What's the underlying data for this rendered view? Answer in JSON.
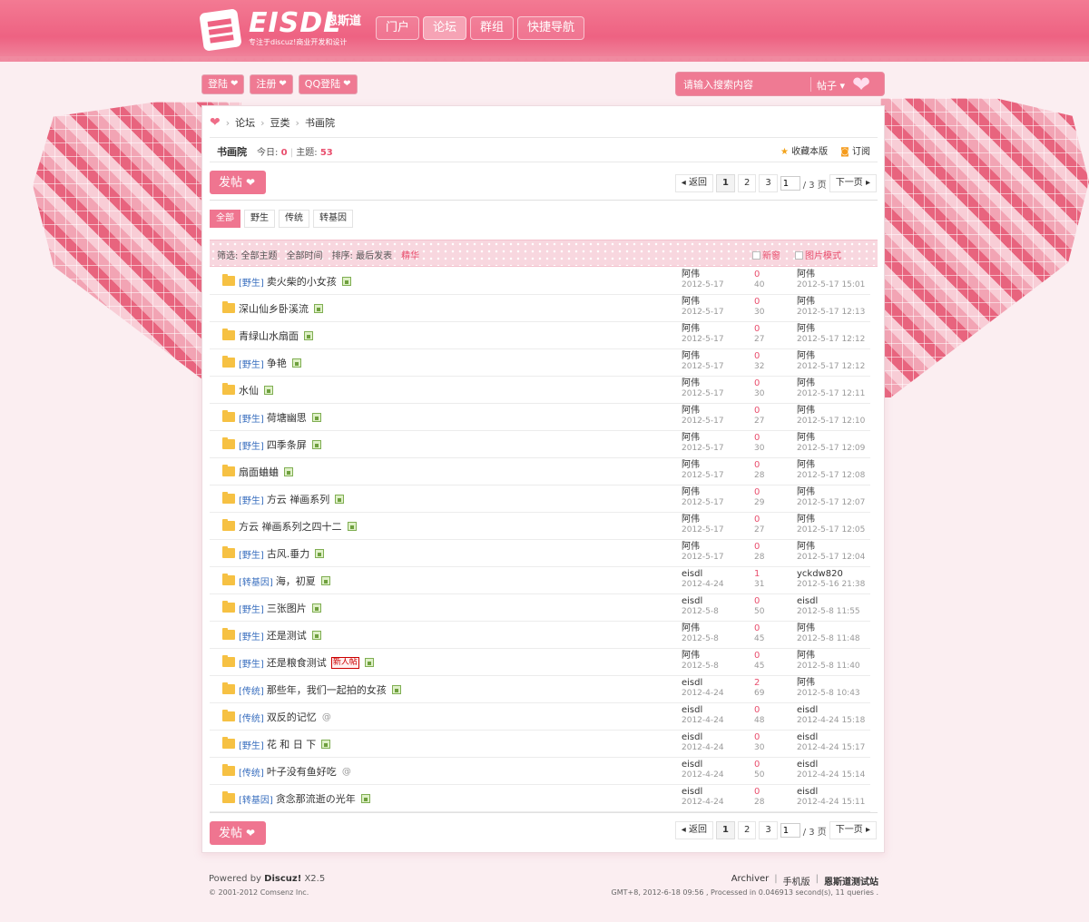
{
  "colors": {
    "brand": "#ee6282",
    "accent": "#ef7590",
    "link": "#3a6fbf",
    "count_red": "#e94f6e",
    "page_bg": "#fbeef1"
  },
  "logo": {
    "text": "EISDL",
    "cn": "恩斯道",
    "slogan": "专注于discuz!商业开发和设计"
  },
  "nav": [
    {
      "label": "门户",
      "active": false
    },
    {
      "label": "论坛",
      "active": true
    },
    {
      "label": "群组",
      "active": false
    },
    {
      "label": "快捷导航",
      "active": false
    }
  ],
  "auth": {
    "login": "登陆",
    "register": "注册",
    "qq_login": "QQ登陆"
  },
  "search": {
    "placeholder": "请输入搜索内容",
    "type": "帖子 ▾"
  },
  "breadcrumb": {
    "forum": "论坛",
    "category": "豆类",
    "board": "书画院"
  },
  "forum": {
    "name": "书画院",
    "today_label": "今日:",
    "today": "0",
    "threads_label": "主题:",
    "threads": "53",
    "favorite": "收藏本版",
    "subscribe": "订阅"
  },
  "post_button": "发帖",
  "pager": {
    "back": "返回",
    "pages": [
      "1",
      "2",
      "3"
    ],
    "current_input": "1",
    "total": "/ 3 页",
    "next": "下一页"
  },
  "type_tabs": [
    {
      "label": "全部",
      "active": true
    },
    {
      "label": "野生",
      "active": false
    },
    {
      "label": "传统",
      "active": false
    },
    {
      "label": "转基因",
      "active": false
    }
  ],
  "filter": {
    "filter_label": "筛选: 全部主题",
    "time": "全部时间",
    "sort": "排序: 最后发表",
    "digest": "精华",
    "new_window": "新窗",
    "image_mode": "图片模式"
  },
  "threads": [
    {
      "cat": "[野生]",
      "title": "卖火柴的小女孩",
      "attach": "img",
      "author": "阿伟",
      "date": "2012-5-17",
      "replies": "0",
      "views": "40",
      "last_user": "阿伟",
      "last_time": "2012-5-17 15:01"
    },
    {
      "cat": "",
      "title": "深山仙乡卧溪流",
      "attach": "img",
      "author": "阿伟",
      "date": "2012-5-17",
      "replies": "0",
      "views": "30",
      "last_user": "阿伟",
      "last_time": "2012-5-17 12:13"
    },
    {
      "cat": "",
      "title": "青绿山水扇面",
      "attach": "img",
      "author": "阿伟",
      "date": "2012-5-17",
      "replies": "0",
      "views": "27",
      "last_user": "阿伟",
      "last_time": "2012-5-17 12:12"
    },
    {
      "cat": "[野生]",
      "title": "争艳",
      "attach": "img",
      "author": "阿伟",
      "date": "2012-5-17",
      "replies": "0",
      "views": "32",
      "last_user": "阿伟",
      "last_time": "2012-5-17 12:12"
    },
    {
      "cat": "",
      "title": "水仙",
      "attach": "img",
      "author": "阿伟",
      "date": "2012-5-17",
      "replies": "0",
      "views": "30",
      "last_user": "阿伟",
      "last_time": "2012-5-17 12:11"
    },
    {
      "cat": "[野生]",
      "title": "荷塘幽思",
      "attach": "img",
      "author": "阿伟",
      "date": "2012-5-17",
      "replies": "0",
      "views": "27",
      "last_user": "阿伟",
      "last_time": "2012-5-17 12:10"
    },
    {
      "cat": "[野生]",
      "title": "四季条屏",
      "attach": "img",
      "author": "阿伟",
      "date": "2012-5-17",
      "replies": "0",
      "views": "30",
      "last_user": "阿伟",
      "last_time": "2012-5-17 12:09"
    },
    {
      "cat": "",
      "title": "扇面蛐蛐",
      "attach": "img",
      "author": "阿伟",
      "date": "2012-5-17",
      "replies": "0",
      "views": "28",
      "last_user": "阿伟",
      "last_time": "2012-5-17 12:08"
    },
    {
      "cat": "[野生]",
      "title": "方云 禅画系列",
      "attach": "img",
      "author": "阿伟",
      "date": "2012-5-17",
      "replies": "0",
      "views": "29",
      "last_user": "阿伟",
      "last_time": "2012-5-17 12:07"
    },
    {
      "cat": "",
      "title": "方云 禅画系列之四十二",
      "attach": "img",
      "author": "阿伟",
      "date": "2012-5-17",
      "replies": "0",
      "views": "27",
      "last_user": "阿伟",
      "last_time": "2012-5-17 12:05"
    },
    {
      "cat": "[野生]",
      "title": "古风.垂力",
      "attach": "img",
      "author": "阿伟",
      "date": "2012-5-17",
      "replies": "0",
      "views": "28",
      "last_user": "阿伟",
      "last_time": "2012-5-17 12:04"
    },
    {
      "cat": "[转基因]",
      "title": "海，初夏",
      "attach": "img",
      "author": "eisdl",
      "date": "2012-4-24",
      "replies": "1",
      "views": "31",
      "last_user": "yckdw820",
      "last_time": "2012-5-16 21:38"
    },
    {
      "cat": "[野生]",
      "title": "三张图片",
      "attach": "img",
      "author": "eisdl",
      "date": "2012-5-8",
      "replies": "0",
      "views": "50",
      "last_user": "eisdl",
      "last_time": "2012-5-8 11:55"
    },
    {
      "cat": "[野生]",
      "title": "还是测试",
      "attach": "img",
      "author": "阿伟",
      "date": "2012-5-8",
      "replies": "0",
      "views": "45",
      "last_user": "阿伟",
      "last_time": "2012-5-8 11:48"
    },
    {
      "cat": "[野生]",
      "title": "还是粮食测试",
      "badge": "新人帖",
      "attach": "img",
      "author": "阿伟",
      "date": "2012-5-8",
      "replies": "0",
      "views": "45",
      "last_user": "阿伟",
      "last_time": "2012-5-8 11:40"
    },
    {
      "cat": "[传统]",
      "title": "那些年，我们一起拍的女孩",
      "attach": "img",
      "author": "eisdl",
      "date": "2012-4-24",
      "replies": "2",
      "views": "69",
      "last_user": "阿伟",
      "last_time": "2012-5-8 10:43"
    },
    {
      "cat": "[传统]",
      "title": "双反的记忆",
      "attach": "clip",
      "author": "eisdl",
      "date": "2012-4-24",
      "replies": "0",
      "views": "48",
      "last_user": "eisdl",
      "last_time": "2012-4-24 15:18"
    },
    {
      "cat": "[野生]",
      "title": "花 和 日 下",
      "attach": "img",
      "author": "eisdl",
      "date": "2012-4-24",
      "replies": "0",
      "views": "30",
      "last_user": "eisdl",
      "last_time": "2012-4-24 15:17"
    },
    {
      "cat": "[传统]",
      "title": "叶子没有鱼好吃",
      "attach": "clip",
      "author": "eisdl",
      "date": "2012-4-24",
      "replies": "0",
      "views": "50",
      "last_user": "eisdl",
      "last_time": "2012-4-24 15:14"
    },
    {
      "cat": "[转基因]",
      "title": "贪念那流逝の光年",
      "attach": "img",
      "author": "eisdl",
      "date": "2012-4-24",
      "replies": "0",
      "views": "28",
      "last_user": "eisdl",
      "last_time": "2012-4-24 15:11"
    }
  ],
  "footer": {
    "powered_prefix": "Powered by",
    "powered_name": "Discuz!",
    "powered_version": "X2.5",
    "copyright": "© 2001-2012 Comsenz Inc.",
    "links": [
      "Archiver",
      "手机版",
      "恩斯道测试站"
    ],
    "gmt": "GMT+8, 2012-6-18 09:56 , Processed in 0.046913 second(s), 11 queries ."
  }
}
